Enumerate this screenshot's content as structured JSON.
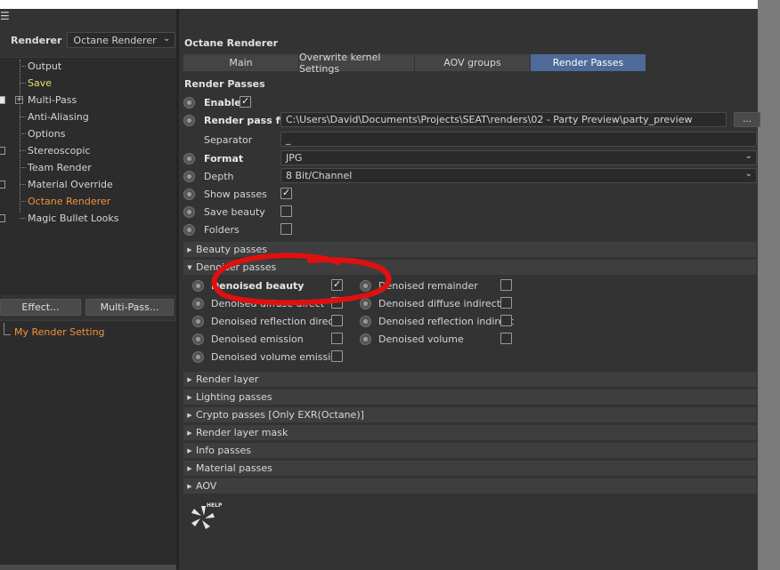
{
  "left_panel": {
    "menu_icon": "hamburger-menu-icon",
    "renderer_label": "Renderer",
    "renderer_value": "Octane Renderer",
    "tree": [
      {
        "label": "Output",
        "color": "normal",
        "checkbox": false
      },
      {
        "label": "Save",
        "color": "yellow",
        "checkbox": false
      },
      {
        "label": "Multi-Pass",
        "color": "normal",
        "checkbox": true,
        "checked": true,
        "expandable": true
      },
      {
        "label": "Anti-Aliasing",
        "color": "normal",
        "checkbox": false
      },
      {
        "label": "Options",
        "color": "normal",
        "checkbox": false
      },
      {
        "label": "Stereoscopic",
        "color": "normal",
        "checkbox": true,
        "checked": false
      },
      {
        "label": "Team Render",
        "color": "normal",
        "checkbox": false
      },
      {
        "label": "Material Override",
        "color": "normal",
        "checkbox": true,
        "checked": false
      },
      {
        "label": "Octane Renderer",
        "color": "orange",
        "checkbox": false
      },
      {
        "label": "Magic Bullet Looks",
        "color": "normal",
        "checkbox": true,
        "checked": false
      }
    ],
    "effect_button": "Effect...",
    "multipass_button": "Multi-Pass...",
    "render_setting": "My Render Setting"
  },
  "right_panel": {
    "header": "Octane Renderer",
    "tabs": [
      {
        "label": "Main",
        "active": false
      },
      {
        "label": "Overwrite kernel Settings",
        "active": false
      },
      {
        "label": "AOV groups",
        "active": false
      },
      {
        "label": "Render Passes",
        "active": true
      }
    ],
    "section_title": "Render Passes",
    "enable_label": "Enable",
    "enable_checked": true,
    "render_pass_file_label": "Render pass file",
    "render_pass_file_value": "C:\\Users\\David\\Documents\\Projects\\SEAT\\renders\\02 - Party Preview\\party_preview",
    "browse_button": "...",
    "separator_label": "Separator",
    "separator_value": "_",
    "format_label": "Format",
    "format_value": "JPG",
    "depth_label": "Depth",
    "depth_value": "8 Bit/Channel",
    "show_passes_label": "Show passes",
    "show_passes_checked": true,
    "save_beauty_label": "Save beauty",
    "save_beauty_checked": false,
    "folders_label": "Folders",
    "folders_checked": false,
    "beauty_passes": "Beauty passes",
    "denoiser_passes": "Denoiser passes",
    "denoiser_items_left": [
      {
        "label": "Denoised beauty",
        "checked": true,
        "bold": true
      },
      {
        "label": "Denoised diffuse direct",
        "checked": false
      },
      {
        "label": "Denoised reflection direct",
        "checked": false
      },
      {
        "label": "Denoised emission",
        "checked": false
      },
      {
        "label": "Denoised volume emission",
        "checked": false
      }
    ],
    "denoiser_items_right": [
      {
        "label": "Denoised remainder",
        "checked": false
      },
      {
        "label": "Denoised diffuse indirect",
        "checked": false
      },
      {
        "label": "Denoised reflection indirect",
        "checked": false
      },
      {
        "label": "Denoised volume",
        "checked": false
      }
    ],
    "collapsed_groups": [
      "Render layer",
      "Lighting passes",
      "Crypto passes [Only EXR(Octane)]",
      "Render layer mask",
      "Info passes",
      "Material passes",
      "AOV"
    ],
    "help_label": "HELP"
  },
  "colors": {
    "active_tab": "#4d6a99",
    "highlight_orange": "#f0923a",
    "highlight_yellow": "#e8e36a",
    "annotation_red": "#e01010"
  }
}
